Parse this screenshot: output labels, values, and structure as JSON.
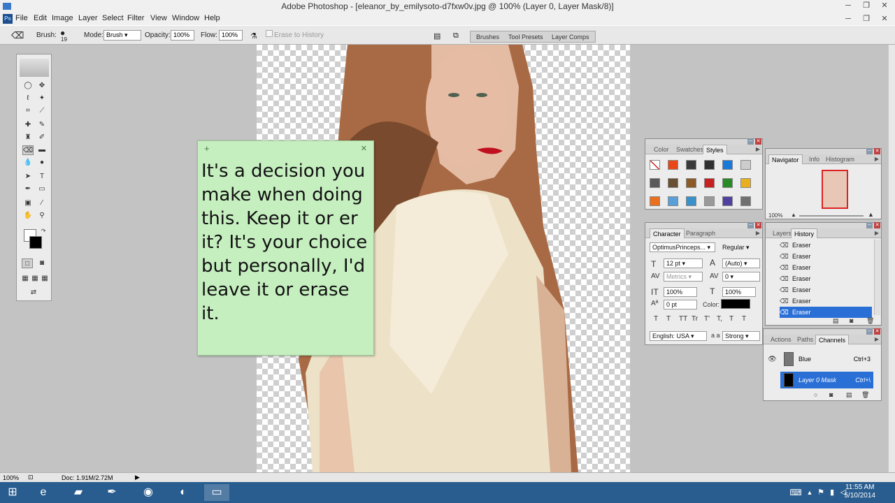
{
  "window": {
    "title": "Adobe Photoshop - [eleanor_by_emilysoto-d7fxw0v.jpg @ 100% (Layer 0, Layer Mask/8)]"
  },
  "menu": {
    "items": [
      "File",
      "Edit",
      "Image",
      "Layer",
      "Select",
      "Filter",
      "View",
      "Window",
      "Help"
    ]
  },
  "options": {
    "brush_label": "Brush:",
    "brush_size": "19",
    "mode_label": "Mode:",
    "mode_value": "Brush",
    "opacity_label": "Opacity:",
    "opacity_value": "100%",
    "flow_label": "Flow:",
    "flow_value": "100%",
    "erase_history": "Erase to History"
  },
  "palette_well": {
    "tabs": [
      "Brushes",
      "Tool Presets",
      "Layer Comps"
    ]
  },
  "sticky_note": {
    "text": "It's a decision you make when doing this. Keep it or er it? It's your choice but personally, I'd leave it or erase it."
  },
  "color_panel": {
    "tabs": [
      "Color",
      "Swatches",
      "Styles"
    ],
    "colors": [
      "#d01818",
      "#e84818",
      "#3a3a3a",
      "#303030",
      "#1a78d8",
      "#cccccc",
      "#5a5a5a",
      "#6a5032",
      "#8a5a28",
      "#c82020",
      "#2a8a2a",
      "#e8b020",
      "#e87020",
      "#5aa0d8",
      "#3a90c8",
      "#9a9a9a",
      "#5040a0",
      "#707070"
    ]
  },
  "navigator": {
    "tabs": [
      "Navigator",
      "Info",
      "Histogram"
    ],
    "zoom": "100%"
  },
  "character": {
    "tabs": [
      "Character",
      "Paragraph"
    ],
    "font_family": "OptimusPrinceps...",
    "font_style": "Regular",
    "font_size": "12 pt",
    "leading": "(Auto)",
    "kerning": "Metrics",
    "tracking": "0",
    "vscale": "100%",
    "hscale": "100%",
    "baseline": "0 pt",
    "color_label": "Color:",
    "style_buttons": [
      "T",
      "T",
      "TT",
      "Tr",
      "T'",
      "T,",
      "T",
      "T"
    ],
    "language": "English: USA",
    "aa_label": "a a",
    "antialias": "Strong"
  },
  "history": {
    "tabs": [
      "Layers",
      "History"
    ],
    "items": [
      "Eraser",
      "Eraser",
      "Eraser",
      "Eraser",
      "Eraser",
      "Eraser",
      "Eraser"
    ]
  },
  "channels": {
    "tabs": [
      "Actions",
      "Paths",
      "Channels"
    ],
    "rows": [
      {
        "name": "Blue",
        "shortcut": "Ctrl+3"
      },
      {
        "name": "Layer 0 Mask",
        "shortcut": "Ctrl+\\"
      }
    ]
  },
  "status": {
    "zoom": "100%",
    "doc": "Doc: 1.91M/2.72M"
  },
  "taskbar": {
    "time": "11:55 AM",
    "date": "5/10/2014"
  }
}
